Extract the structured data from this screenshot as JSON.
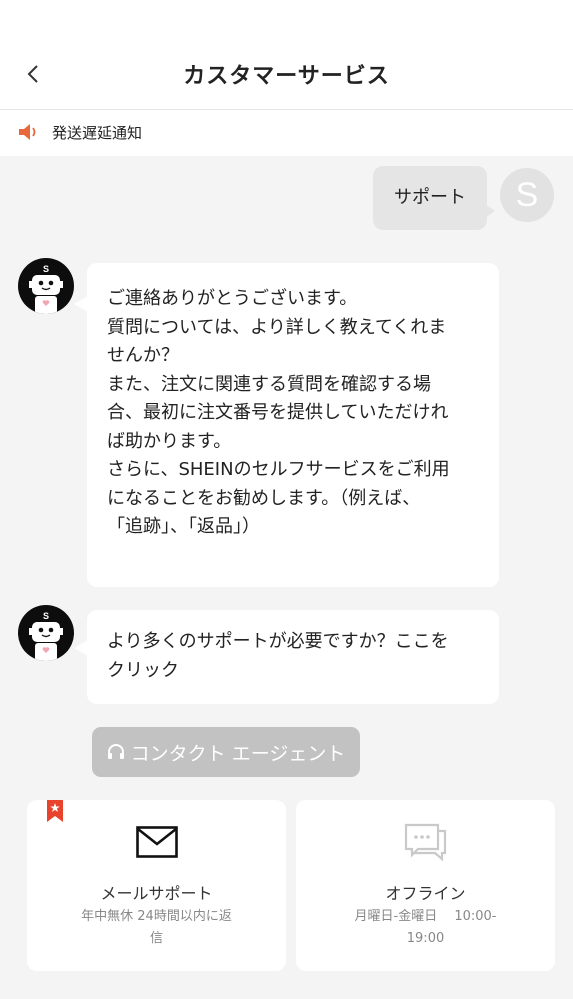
{
  "header": {
    "title": "カスタマーサービス"
  },
  "notice": {
    "text": "発送遅延通知"
  },
  "chat": {
    "user_message": "サポート",
    "user_initial": "S",
    "bot_avatar_letter": "S",
    "bot_message_1": [
      "ご連絡ありがとうございます。",
      "質問については、より詳しく教えてくれま",
      "せんか？",
      "また、注文に関連する質問を確認する場",
      "合、最初に注文番号を提供していただけれ",
      "ば助かります。",
      "さらに、SHEINのセルフサービスをご利用",
      "になることをお勧めします。（例えば、",
      "「追跡」、「返品」）"
    ],
    "bot_message_2": [
      "より多くのサポートが必要ですか？ここを",
      "クリック"
    ]
  },
  "contact_button": {
    "label": "コンタクト エージェント"
  },
  "cards": {
    "email": {
      "title": "メールサポート",
      "subtitle_line1": "年中無休 24時間以内に返",
      "subtitle_line2": "信"
    },
    "offline": {
      "title": "オフライン",
      "subtitle_line1": "月曜日-金曜日　 10:00-",
      "subtitle_line2": "19:00"
    }
  },
  "colors": {
    "accent": "#e8432d",
    "speaker": "#e86a3c",
    "disabled_button": "#c2c2c2",
    "icon_gray": "#c9c9c9"
  },
  "icons": [
    "back-arrow-icon",
    "speaker-icon",
    "robot-avatar-icon",
    "headset-icon",
    "envelope-icon",
    "chat-bubble-icon",
    "star-bookmark-icon"
  ]
}
